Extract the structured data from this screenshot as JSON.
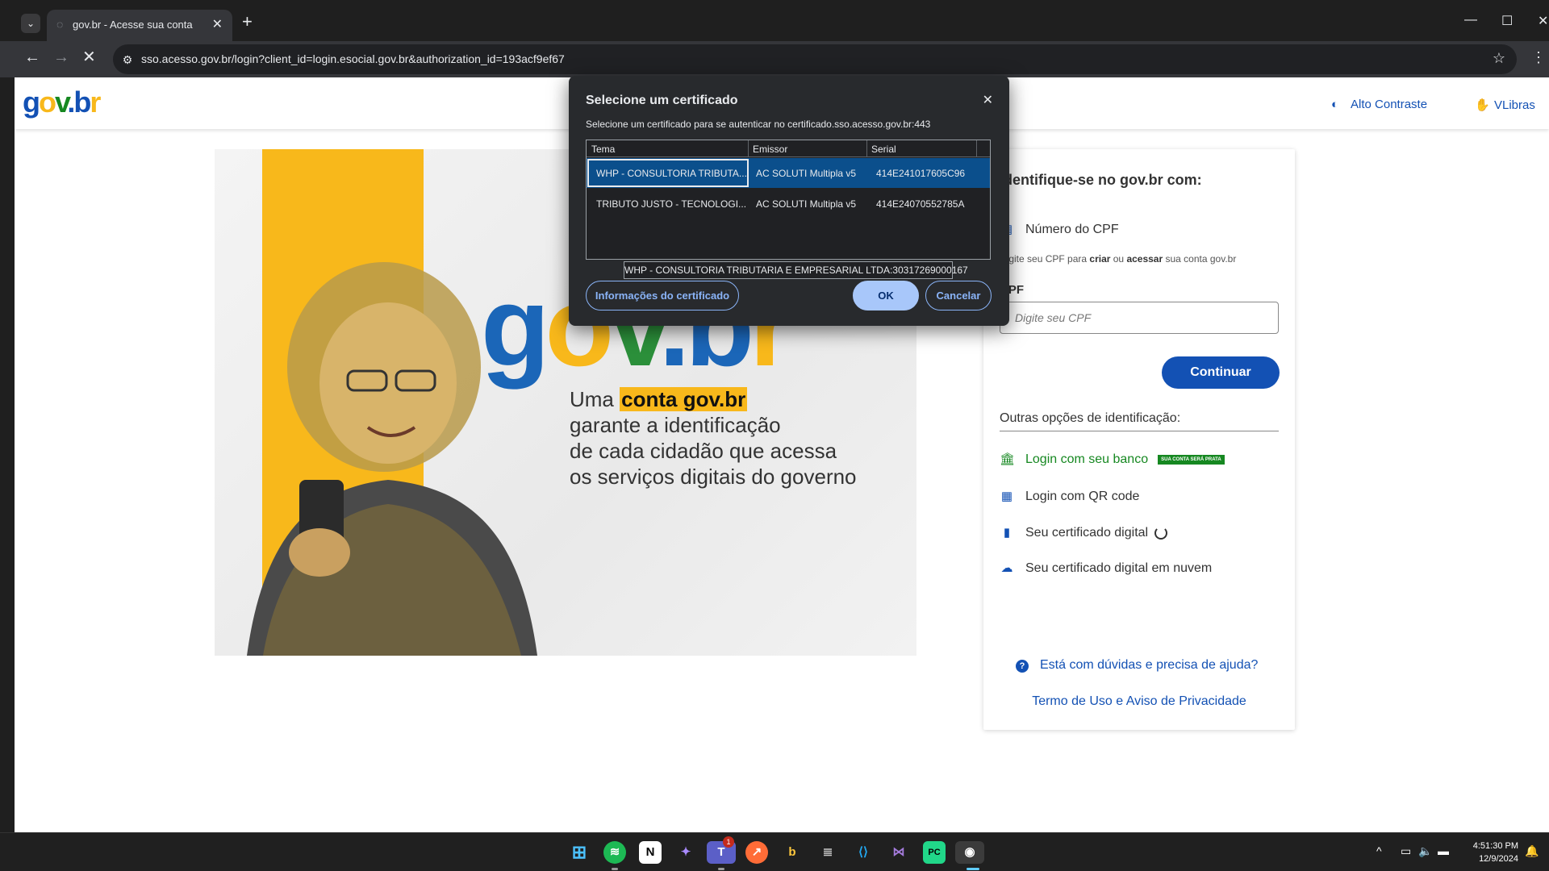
{
  "browser": {
    "tab_title": "gov.br - Acesse sua conta",
    "url": "sso.acesso.gov.br/login?client_id=login.esocial.gov.br&authorization_id=193acf9ef67"
  },
  "header": {
    "logo_g": "g",
    "logo_o": "o",
    "logo_v": "v",
    "logo_dot": ".",
    "logo_b": "b",
    "logo_r": "r",
    "alto_contraste": "Alto Contraste",
    "vlibras": "VLibras"
  },
  "hero": {
    "big_g": "g",
    "big_o": "o",
    "big_v": "v",
    "big_dot": ".",
    "big_b": "b",
    "big_r": "r",
    "slogan_prefix": "Uma ",
    "slogan_highlight": "conta gov.br",
    "slogan_line2": "garante a identificação",
    "slogan_line3": "de cada cidadão que acessa",
    "slogan_line4": "os serviços digitais do governo"
  },
  "login_card": {
    "title": "Identifique-se no gov.br com:",
    "cpf_option": "Número do CPF",
    "help_prefix": "Digite seu CPF para ",
    "help_criar": "criar",
    "help_mid": " ou ",
    "help_acessar": "acessar",
    "help_suffix": " sua conta gov.br",
    "cpf_label": "CPF",
    "cpf_placeholder": "Digite seu CPF",
    "continuar": "Continuar",
    "outras_opcoes": "Outras opções de identificação:",
    "opt_banco": "Login com seu banco",
    "opt_banco_badge": "SUA CONTA SERÁ PRATA",
    "opt_qr": "Login com QR code",
    "opt_cert": "Seu certificado digital",
    "opt_cert_nuvem": "Seu certificado digital em nuvem",
    "duvidas": "Está com dúvidas e precisa de ajuda?",
    "termo": "Termo de Uso e Aviso de Privacidade"
  },
  "dialog": {
    "title": "Selecione um certificado",
    "subtitle": "Selecione um certificado para se autenticar no certificado.sso.acesso.gov.br:443",
    "columns": [
      "Tema",
      "Emissor",
      "Serial"
    ],
    "rows": [
      {
        "tema": "WHP - CONSULTORIA TRIBUTA...",
        "emissor": "AC SOLUTI Multipla v5",
        "serial": "414E241017605C96"
      },
      {
        "tema": "TRIBUTO JUSTO - TECNOLOGI...",
        "emissor": "AC SOLUTI Multipla v5",
        "serial": "414E24070552785A"
      }
    ],
    "selected_row": 0,
    "tooltip": "WHP - CONSULTORIA TRIBUTARIA E EMPRESARIAL LTDA:30317269000167",
    "info_button": "Informações do certificado",
    "ok_button": "OK",
    "cancel_button": "Cancelar"
  },
  "taskbar": {
    "teams_badge": "1",
    "time": "4:51:30 PM",
    "date": "12/9/2024"
  },
  "icons": {
    "tab_search": "chevron-down-icon",
    "favicon": "loading-icon",
    "close": "close-icon",
    "new_tab": "plus-icon",
    "back": "arrow-left-icon",
    "forward": "arrow-right-icon",
    "stop": "stop-loading-icon",
    "site_info": "tune-icon",
    "bookmark": "star-icon",
    "contrast": "contrast-icon",
    "vlibras": "hand-sign-icon"
  },
  "colors": {
    "govbr_blue": "#1351b4",
    "govbr_yellow": "#f8b81b",
    "govbr_green": "#168821",
    "dialog_selected_row": "#0b4f8c"
  }
}
